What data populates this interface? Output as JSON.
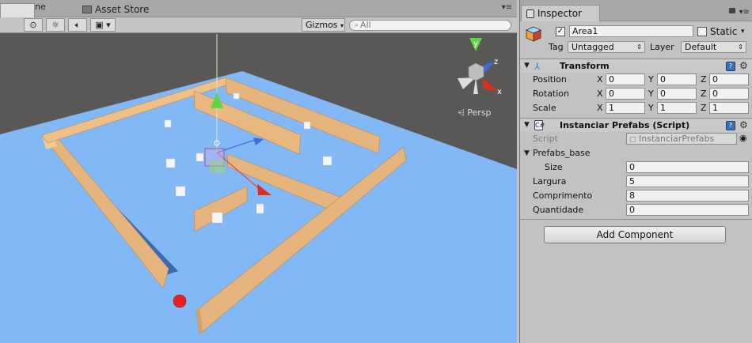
{
  "scene_tabs": {
    "scene_fragment": "ne",
    "asset_store": "Asset Store"
  },
  "scene_toolbar": {
    "gizmos_label": "Gizmos",
    "search_placeholder": "All",
    "projection_label": "Persp",
    "axes": {
      "x": "x",
      "y": "y",
      "z": "z"
    }
  },
  "inspector": {
    "tab_label": "Inspector",
    "object": {
      "active": true,
      "name": "Area1",
      "static_label": "Static",
      "static": false,
      "tag_label": "Tag",
      "tag_value": "Untagged",
      "layer_label": "Layer",
      "layer_value": "Default"
    },
    "transform": {
      "title": "Transform",
      "rows": [
        {
          "label": "Position",
          "x": "0",
          "y": "0",
          "z": "0"
        },
        {
          "label": "Rotation",
          "x": "0",
          "y": "0",
          "z": "0"
        },
        {
          "label": "Scale",
          "x": "1",
          "y": "1",
          "z": "1"
        }
      ],
      "axis_labels": [
        "X",
        "Y",
        "Z"
      ]
    },
    "script_component": {
      "title": "Instanciar Prefabs (Script)",
      "script_label": "Script",
      "script_value": "InstanciarPrefabs",
      "prefabs_label": "Prefabs_base",
      "size_label": "Size",
      "size_value": "0",
      "largura_label": "Largura",
      "largura_value": "5",
      "comprimento_label": "Comprimento",
      "comprimento_value": "8",
      "quantidade_label": "Quantidade",
      "quantidade_value": "0"
    },
    "add_component": "Add Component"
  },
  "colors": {
    "floor": "#82b8f6",
    "wall": "#e5b57d",
    "wall_shadow": "#2c4f9a",
    "background": "#595857"
  }
}
